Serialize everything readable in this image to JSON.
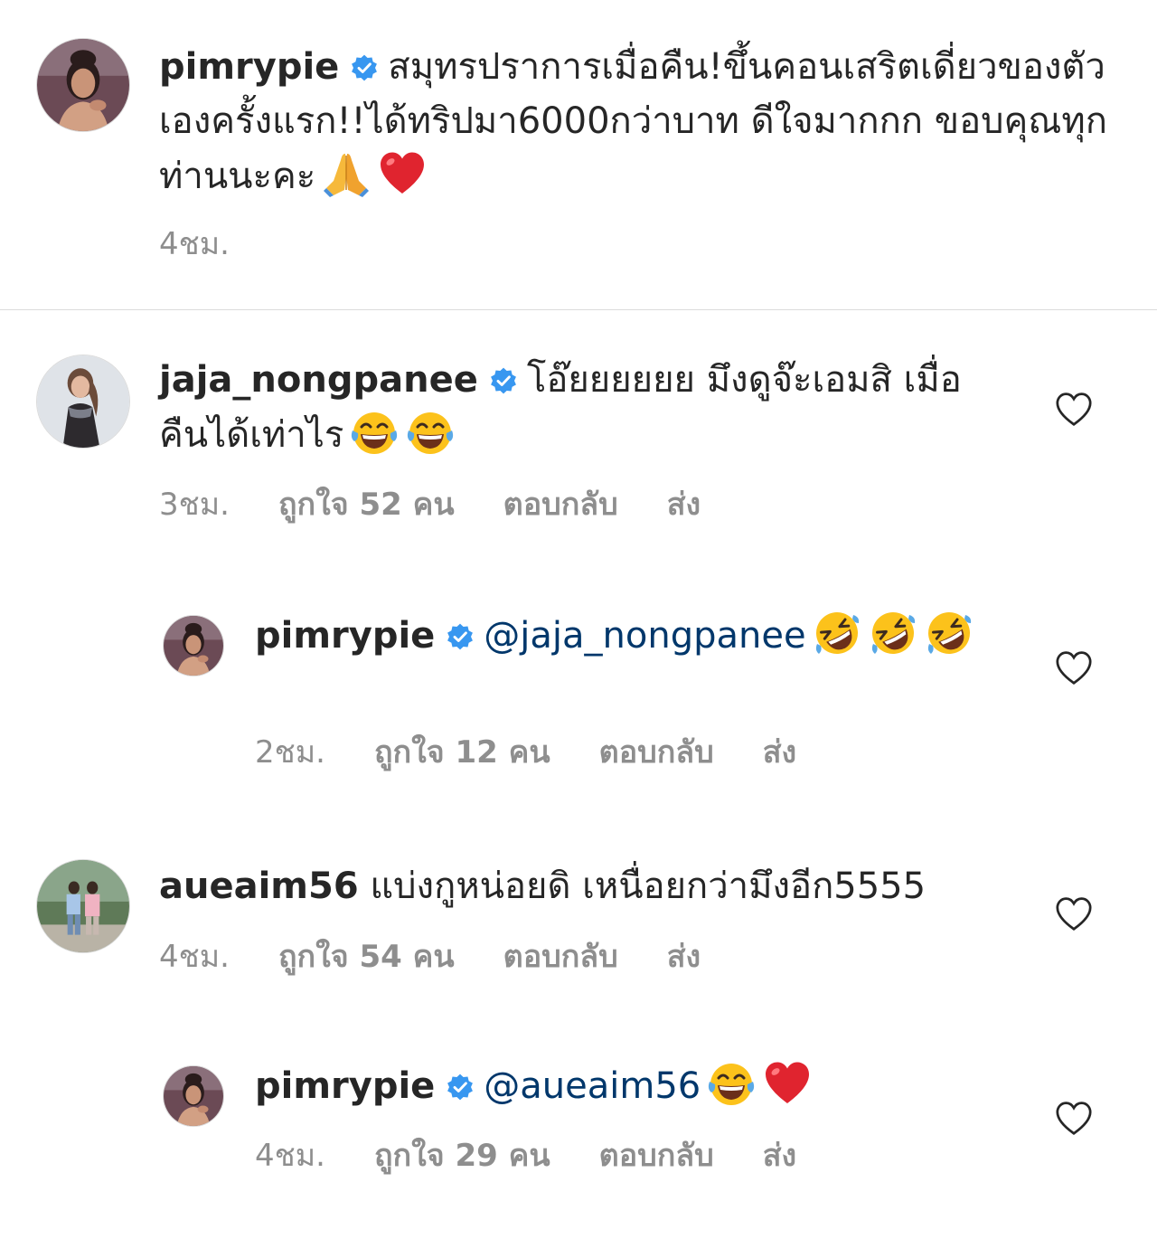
{
  "caption": {
    "username": "pimrypie",
    "text": "สมุทรปราการเมื่อคืน!ขึ้นคอนเสริตเดี่ยวของตัวเองครั้งแรก!!ได้ทริปมา6000กว่าบาท ดีใจมากกก ขอบคุณทุกท่านนะคะ",
    "emojis": [
      "praying-hands",
      "red-heart"
    ],
    "time": "4ชม."
  },
  "comments": [
    {
      "username": "jaja_nongpanee",
      "verified": true,
      "text": "โอ๊ยยยยยย มึงดูจ๊ะเอมสิ เมื่อคืนได้เท่าไร",
      "emojis": [
        "joy",
        "joy"
      ],
      "time": "3ชม.",
      "likes": "ถูกใจ 52 คน",
      "reply": "ตอบกลับ",
      "send": "ส่ง"
    },
    {
      "username": "pimrypie",
      "verified": true,
      "mention": "@jaja_nongpanee",
      "emojis": [
        "rofl",
        "rofl",
        "rofl"
      ],
      "time": "2ชม.",
      "likes": "ถูกใจ 12 คน",
      "reply": "ตอบกลับ",
      "send": "ส่ง"
    },
    {
      "username": "aueaim56",
      "verified": false,
      "text": "แบ่งกูหน่อยดิ เหนื่อยกว่ามึงอีก5555",
      "time": "4ชม.",
      "likes": "ถูกใจ 54 คน",
      "reply": "ตอบกลับ",
      "send": "ส่ง"
    },
    {
      "username": "pimrypie",
      "verified": true,
      "mention": "@aueaim56",
      "emojis": [
        "joy",
        "red-heart"
      ],
      "time": "4ชม.",
      "likes": "ถูกใจ 29 คน",
      "reply": "ตอบกลับ",
      "send": "ส่ง"
    }
  ],
  "colors": {
    "text": "#262626",
    "meta": "#8e8e8e",
    "mention": "#00376b",
    "verified": "#3897f0",
    "divider": "#dbdbdb"
  }
}
